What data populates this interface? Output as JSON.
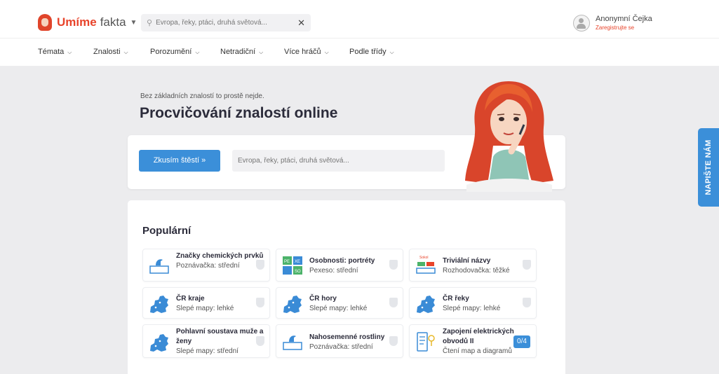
{
  "header": {
    "logo_strong": "Umíme",
    "logo_light": "fakta",
    "search_placeholder": "Evropa, řeky, ptáci, druhá světová...",
    "user_name": "Anonymní Čejka",
    "user_register": "Zaregistrujte se"
  },
  "nav": {
    "items": [
      {
        "label": "Témata"
      },
      {
        "label": "Znalosti"
      },
      {
        "label": "Porozumění"
      },
      {
        "label": "Netradiční"
      },
      {
        "label": "Více hráčů"
      },
      {
        "label": "Podle třídy"
      }
    ]
  },
  "hero": {
    "subtitle": "Bez základních znalostí to prostě nejde.",
    "title": "Procvičování znalostí online",
    "lucky_button": "Zkusím štěstí »",
    "search_placeholder": "Evropa, řeky, ptáci, druhá světová..."
  },
  "popular": {
    "title": "Populární",
    "tiles": [
      {
        "title": "Značky chemických prvků",
        "meta": "Poznávačka: střední",
        "icon": "flask-icon"
      },
      {
        "title": "Osobnosti: portréty",
        "meta": "Pexeso: střední",
        "icon": "pexeso-icon",
        "icon_letters": [
          "PE",
          "XE",
          "SO"
        ]
      },
      {
        "title": "Triviální názvy",
        "meta": "Rozhodovačka: těžké",
        "icon": "decision-icon",
        "icon_word": "Sokol"
      },
      {
        "title": "ČR kraje",
        "meta": "Slepé mapy: lehké",
        "icon": "map-icon"
      },
      {
        "title": "ČR hory",
        "meta": "Slepé mapy: lehké",
        "icon": "map-icon"
      },
      {
        "title": "ČR řeky",
        "meta": "Slepé mapy: lehké",
        "icon": "map-icon"
      },
      {
        "title": "Pohlavní soustava muže a ženy",
        "meta": "Slepé mapy: střední",
        "icon": "map-icon"
      },
      {
        "title": "Nahosemenné rostliny",
        "meta": "Poznávačka: střední",
        "icon": "flask-icon"
      },
      {
        "title": "Zapojení elektrických obvodů II",
        "meta": "Čtení map a diagramů",
        "icon": "diagram-icon",
        "badge": "0/4"
      }
    ]
  },
  "side_tab": {
    "label": "NAPIŠTE NÁM"
  },
  "colors": {
    "accent": "#e8442b",
    "primary": "#3b8fd9",
    "map": "#3a8bd6"
  }
}
